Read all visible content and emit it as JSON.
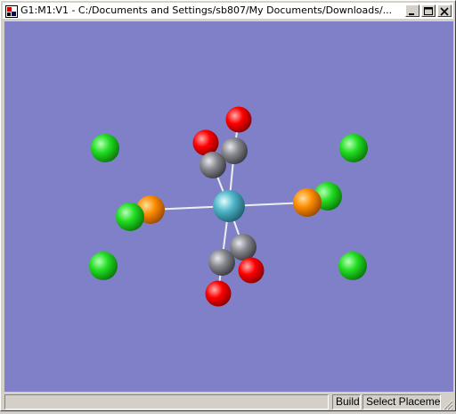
{
  "window": {
    "title": "G1:M1:V1 - C:/Documents and Settings/sb807/My Documents/Downloads/...",
    "app_icon": "gaussview-icon",
    "controls": {
      "minimize": "minimize-icon",
      "maximize": "maximize-icon",
      "close": "close-icon"
    }
  },
  "viewport": {
    "background": "#8080c8",
    "molecule": {
      "atom_colors": {
        "metal": "#50b4c8",
        "carbon": "#888890",
        "oxygen": "#ff0000",
        "phosphorus": "#ff8c00",
        "chlorine": "#22dd22"
      }
    }
  },
  "statusbar": {
    "message": "",
    "mode": "Build",
    "action": "Select Placement"
  }
}
